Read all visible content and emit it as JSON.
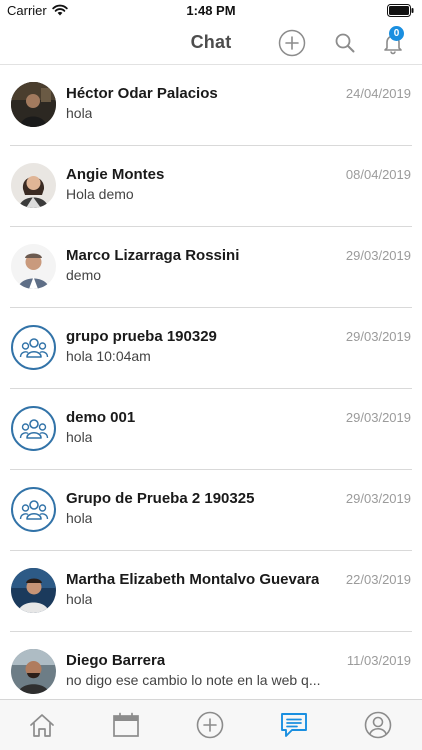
{
  "status_bar": {
    "carrier": "Carrier",
    "time": "1:48 PM",
    "icons": [
      "wifi-icon",
      "battery-icon"
    ]
  },
  "header": {
    "title": "Chat",
    "actions": [
      "add-circle-icon",
      "search-icon",
      "bell-icon"
    ],
    "notification_count": "0"
  },
  "chats": [
    {
      "name": "Héctor Odar Palacios",
      "preview": "hola",
      "date": "24/04/2019",
      "avatar": "photo"
    },
    {
      "name": "Angie Montes",
      "preview": "Hola demo",
      "date": "08/04/2019",
      "avatar": "photo"
    },
    {
      "name": "Marco Lizarraga Rossini",
      "preview": "demo",
      "date": "29/03/2019",
      "avatar": "photo"
    },
    {
      "name": "grupo prueba 190329",
      "preview": "hola 10:04am",
      "date": "29/03/2019",
      "avatar": "group-icon"
    },
    {
      "name": "demo 001",
      "preview": "hola",
      "date": "29/03/2019",
      "avatar": "group-icon"
    },
    {
      "name": "Grupo de Prueba 2 190325",
      "preview": "hola",
      "date": "29/03/2019",
      "avatar": "group-icon"
    },
    {
      "name": "Martha Elizabeth Montalvo Guevara",
      "preview": "hola",
      "date": "22/03/2019",
      "avatar": "photo"
    },
    {
      "name": "Diego Barrera",
      "preview": "no digo ese cambio lo note en la web q...",
      "date": "11/03/2019",
      "avatar": "photo"
    }
  ],
  "tab_bar": {
    "tabs": [
      "home-icon",
      "calendar-icon",
      "add-circle-icon",
      "chat-icon",
      "profile-icon"
    ],
    "active": "chat-icon"
  },
  "colors": {
    "accent": "#1a8fe0",
    "group_ring": "#3273a8",
    "icon_gray": "#8c8c8c",
    "date_gray": "#9b9b9b",
    "divider": "#d9d9d9",
    "tab_bar_bg": "#f7f7f7"
  }
}
